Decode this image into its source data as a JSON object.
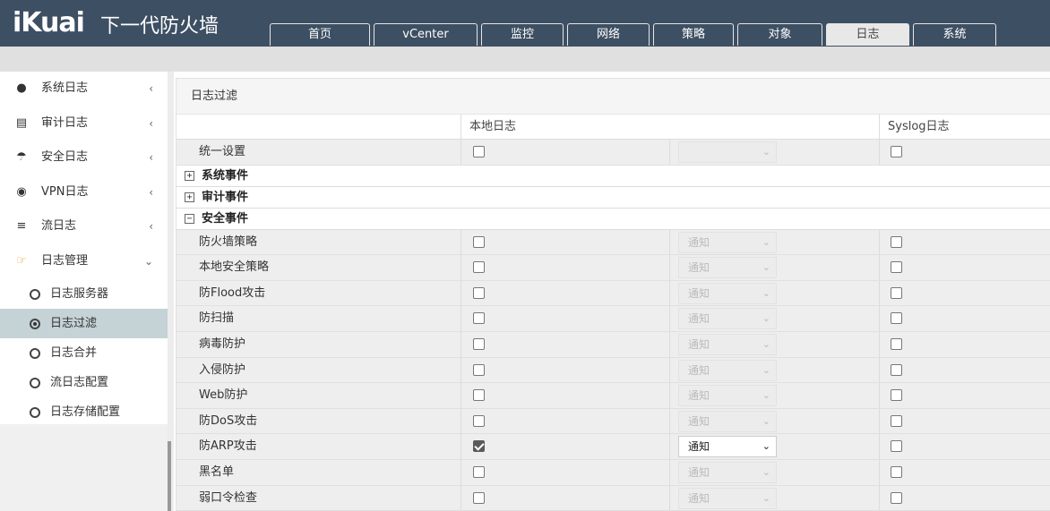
{
  "header": {
    "logo": "iKuai",
    "product": "下一代防火墙",
    "tabs": [
      "首页",
      "vCenter",
      "监控",
      "网络",
      "策略",
      "对象",
      "日志",
      "系统"
    ],
    "active_tab": "日志"
  },
  "sidebar": {
    "items": [
      {
        "label": "系统日志",
        "icon": "tag-icon"
      },
      {
        "label": "审计日志",
        "icon": "list-icon"
      },
      {
        "label": "安全日志",
        "icon": "umbrella-icon"
      },
      {
        "label": "VPN日志",
        "icon": "lock-icon"
      },
      {
        "label": "流日志",
        "icon": "sliders-icon"
      },
      {
        "label": "日志管理",
        "icon": "hand-pointer-icon"
      }
    ],
    "sub_items": [
      "日志服务器",
      "日志过滤",
      "日志合并",
      "流日志配置",
      "日志存储配置"
    ],
    "active_sub": "日志过滤"
  },
  "panel": {
    "title": "日志过滤",
    "col_local": "本地日志",
    "col_syslog": "Syslog日志",
    "unified": "统一设置",
    "groups": {
      "system": "系统事件",
      "audit": "审计事件",
      "security": "安全事件"
    },
    "rows": [
      {
        "name": "防火墙策略",
        "level": "通知",
        "local": false,
        "syslog": false
      },
      {
        "name": "本地安全策略",
        "level": "通知",
        "local": false,
        "syslog": false
      },
      {
        "name": "防Flood攻击",
        "level": "通知",
        "local": false,
        "syslog": false
      },
      {
        "name": "防扫描",
        "level": "通知",
        "local": false,
        "syslog": false
      },
      {
        "name": "病毒防护",
        "level": "通知",
        "local": false,
        "syslog": false
      },
      {
        "name": "入侵防护",
        "level": "通知",
        "local": false,
        "syslog": false
      },
      {
        "name": "Web防护",
        "level": "通知",
        "local": false,
        "syslog": false
      },
      {
        "name": "防DoS攻击",
        "level": "通知",
        "local": false,
        "syslog": false
      },
      {
        "name": "防ARP攻击",
        "level": "通知",
        "local": true,
        "syslog": false
      },
      {
        "name": "黑名单",
        "level": "通知",
        "local": false,
        "syslog": false
      },
      {
        "name": "弱口令检查",
        "level": "通知",
        "local": false,
        "syslog": false
      }
    ]
  }
}
